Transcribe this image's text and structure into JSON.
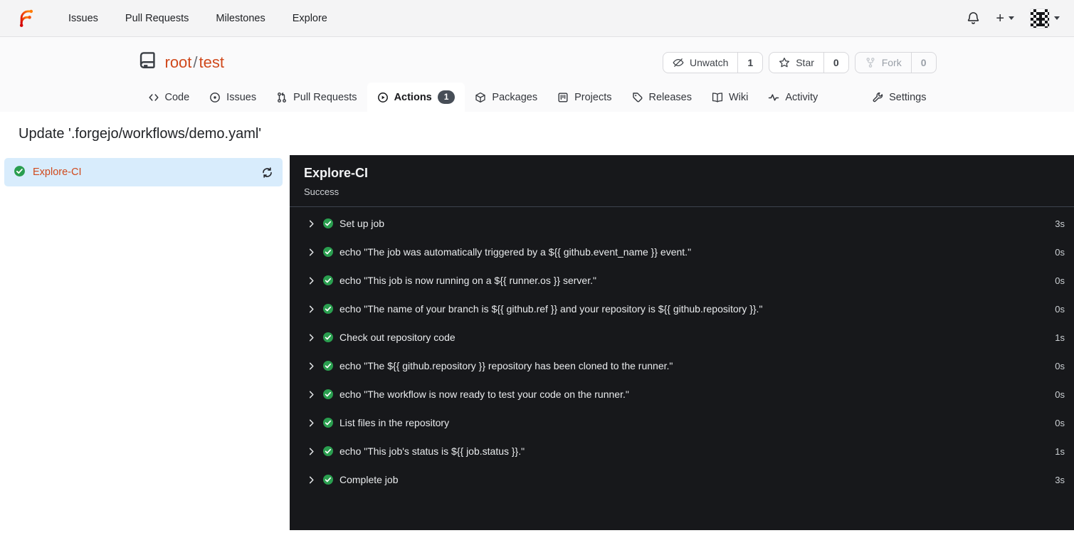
{
  "navbar": {
    "links": [
      {
        "label": "Issues"
      },
      {
        "label": "Pull Requests"
      },
      {
        "label": "Milestones"
      },
      {
        "label": "Explore"
      }
    ],
    "create_label": "+",
    "icons": {
      "logo": "forgejo-logo",
      "notifications": "bell",
      "create": "plus",
      "user_menu": "avatar-identicon"
    }
  },
  "repo": {
    "owner": "root",
    "separator": "/",
    "name": "test",
    "actions": [
      {
        "label": "Unwatch",
        "count": "1"
      },
      {
        "label": "Star",
        "count": "0"
      },
      {
        "label": "Fork",
        "count": "0"
      }
    ],
    "tabs": [
      {
        "label": "Code"
      },
      {
        "label": "Issues"
      },
      {
        "label": "Pull Requests"
      },
      {
        "label": "Actions",
        "badge": "1"
      },
      {
        "label": "Packages"
      },
      {
        "label": "Projects"
      },
      {
        "label": "Releases"
      },
      {
        "label": "Wiki"
      },
      {
        "label": "Activity"
      },
      {
        "label": "Settings"
      }
    ]
  },
  "run": {
    "title": "Update '.forgejo/workflows/demo.yaml'",
    "jobs": [
      {
        "name": "Explore-CI",
        "status": "success"
      }
    ],
    "panel": {
      "title": "Explore-CI",
      "status": "Success"
    },
    "steps": [
      {
        "label": "Set up job",
        "duration": "3s"
      },
      {
        "label": "echo \"The job was automatically triggered by a ${{ github.event_name }} event.\"",
        "duration": "0s"
      },
      {
        "label": "echo \"This job is now running on a ${{ runner.os }} server.\"",
        "duration": "0s"
      },
      {
        "label": "echo \"The name of your branch is ${{ github.ref }} and your repository is ${{ github.repository }}.\"",
        "duration": "0s"
      },
      {
        "label": "Check out repository code",
        "duration": "1s"
      },
      {
        "label": "echo \"The ${{ github.repository }} repository has been cloned to the runner.\"",
        "duration": "0s"
      },
      {
        "label": "echo \"The workflow is now ready to test your code on the runner.\"",
        "duration": "0s"
      },
      {
        "label": "List files in the repository",
        "duration": "0s"
      },
      {
        "label": "echo \"This job's status is ${{ job.status }}.\"",
        "duration": "1s"
      },
      {
        "label": "Complete job",
        "duration": "3s"
      }
    ]
  },
  "colors": {
    "accent_orange": "#d0491c",
    "success_green": "#2a9e4f",
    "selected_blue": "#d8ecfc",
    "panel_dark": "#17181b",
    "badge_gray": "#474e57"
  }
}
